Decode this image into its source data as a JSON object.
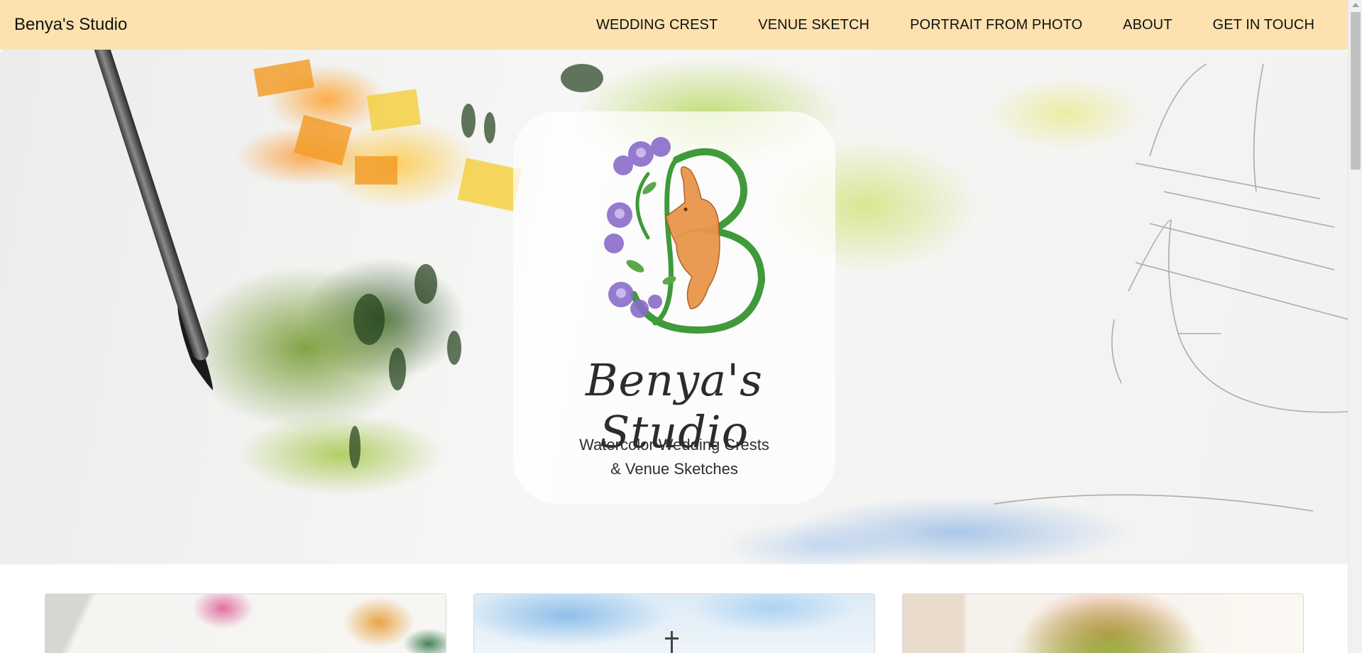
{
  "navbar": {
    "brand": "Benya's Studio",
    "links": [
      "WEDDING CREST",
      "VENUE SKETCH",
      "PORTRAIT FROM PHOTO",
      "ABOUT",
      "GET IN TOUCH"
    ],
    "background_color": "#fde2b0"
  },
  "hero": {
    "title": "Benya's Studio",
    "tagline_line1": "Watercolor Wedding Crests",
    "tagline_line2": "& Venue Sketches"
  },
  "gallery": {
    "cards": [
      {
        "icon": "wedding-crest-thumbnail"
      },
      {
        "icon": "venue-sketch-thumbnail"
      },
      {
        "icon": "portrait-thumbnail"
      }
    ]
  },
  "colors": {
    "accent": "#fde2b0",
    "crest_green": "#3f9a3a",
    "crest_orange": "#e8964a",
    "crest_purple": "#8a6cc9"
  }
}
